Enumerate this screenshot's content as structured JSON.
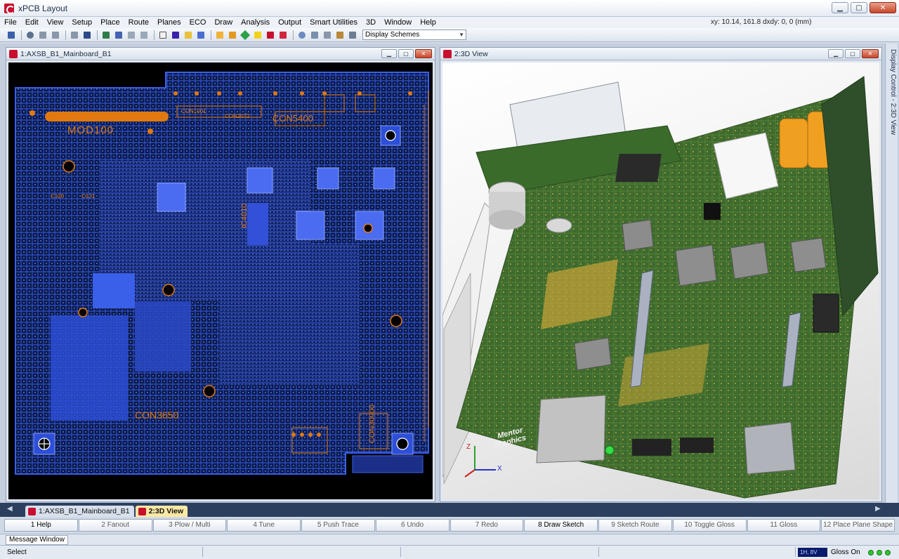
{
  "window": {
    "title": "xPCB Layout"
  },
  "menu": [
    "File",
    "Edit",
    "View",
    "Setup",
    "Place",
    "Route",
    "Planes",
    "ECO",
    "Draw",
    "Analysis",
    "Output",
    "Smart Utilities",
    "3D",
    "Window",
    "Help"
  ],
  "coords": "xy: 10.14, 161.8  dxdy: 0, 0  (mm)",
  "toolbar": {
    "scheme_select": "Display Schemes"
  },
  "windows": {
    "layout": {
      "title": "1:AXSB_B1_Mainboard_B1"
    },
    "view3d": {
      "title": "2:3D View",
      "brand_line1": "Mentor",
      "brand_line2": "Graphics",
      "axis_z": "Z",
      "axis_x": "X"
    }
  },
  "pcb_labels": {
    "mod100": "MOD100",
    "con1001": "CON1001",
    "con2072": "CON2072",
    "con5400": "CON5400",
    "ic4010": "IC4010",
    "c120": "C120",
    "c121": "C121",
    "con3650": "CON3650",
    "con30000": "CON30000"
  },
  "display_control": {
    "label": "Display Control - 2:3D View"
  },
  "doc_tabs": [
    "1:AXSB_B1_Mainboard_B1",
    "2:3D View"
  ],
  "fkeys": [
    "1 Help",
    "2 Fanout",
    "3 Plow / Multi",
    "4 Tune",
    "5 Push Trace",
    "6 Undo",
    "7 Redo",
    "8 Draw Sketch",
    "9 Sketch Route",
    "10 Toggle Gloss",
    "11 Gloss",
    "12 Place Plane Shape"
  ],
  "message_window": {
    "tab": "Message Window"
  },
  "status": {
    "mode": "Select",
    "layer": "1H, 8V",
    "gloss": "Gloss On"
  },
  "colors": {
    "pcb_bg": "#000000",
    "copper": "#3a5fe8",
    "silk": "#e07a10",
    "board": "#3e6a2e",
    "accent": "#c8102e"
  }
}
